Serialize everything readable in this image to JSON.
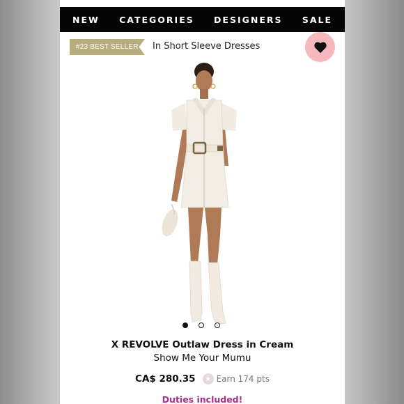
{
  "nav": {
    "items": [
      "NEW",
      "CATEGORIES",
      "DESIGNERS",
      "SALE"
    ]
  },
  "badge": {
    "label": "#23 BEST SELLER",
    "category": "In Short Sleeve Dresses"
  },
  "favorite_icon": "heart-icon",
  "carousel": {
    "count": 3,
    "active_index": 0
  },
  "product": {
    "title": "X REVOLVE Outlaw Dress in Cream",
    "brand": "Show Me Your Mumu",
    "price": "CA$ 280.35",
    "points": "Earn 174 pts",
    "duties": "Duties included!"
  },
  "colors": {
    "navbar": "#050505",
    "ribbon": "#b7ad7e",
    "favorite_bg": "#f6b8bd",
    "duties": "#a3308a"
  }
}
